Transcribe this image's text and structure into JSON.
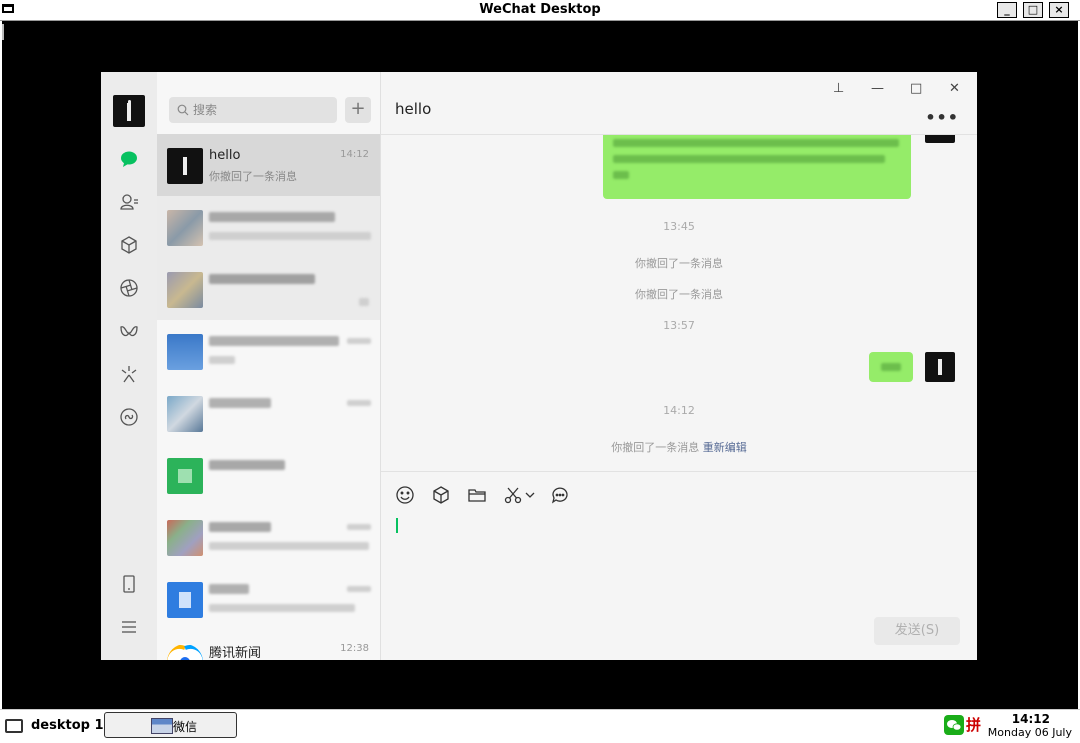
{
  "outer_window": {
    "title": "WeChat Desktop",
    "buttons": [
      "_",
      "□",
      "×"
    ]
  },
  "search": {
    "placeholder": "搜索",
    "plus_label": "+"
  },
  "conversations": [
    {
      "name": "hello",
      "preview": "你撤回了一条消息",
      "time": "14:12",
      "selected": true
    },
    {
      "name": "",
      "preview": "",
      "time": "",
      "blurred": true
    },
    {
      "name": "",
      "preview": "",
      "time": "",
      "blurred": true
    },
    {
      "name": "",
      "preview": "",
      "time": "",
      "blurred": true
    },
    {
      "name": "",
      "preview": "",
      "time": "",
      "blurred": true
    },
    {
      "name": "",
      "preview": "",
      "time": "",
      "blurred": true
    },
    {
      "name": "",
      "preview": "",
      "time": "",
      "blurred": true
    },
    {
      "name": "",
      "preview": "",
      "time": "",
      "blurred": true
    },
    {
      "name": "腾讯新闻",
      "preview": "…",
      "time": "12:38"
    }
  ],
  "chat": {
    "title": "hello",
    "more_label": "•••",
    "window_controls": [
      "⊥",
      "—",
      "□",
      "✕"
    ],
    "timestamps": [
      "13:45",
      "13:57",
      "14:12"
    ],
    "recalled_notes": [
      "你撤回了一条消息",
      "你撤回了一条消息"
    ],
    "last_recall": {
      "text": "你撤回了一条消息",
      "link": "重新编辑"
    },
    "send_label": "发送(S)"
  },
  "nav_icons": [
    "chat-icon",
    "contacts-icon",
    "favorites-icon",
    "moments-icon",
    "channels-icon",
    "search-discover-icon",
    "mini-program-icon",
    "phone-icon",
    "menu-icon"
  ],
  "toolbar_icons": [
    "emoji-icon",
    "favorites-icon",
    "folder-icon",
    "scissors-icon",
    "chevron-down-icon",
    "chat-history-icon"
  ],
  "taskbar": {
    "desktop_label": "desktop 1",
    "task_label": "微信",
    "tray_label": "拼",
    "clock_time": "14:12",
    "clock_date": "Monday 06 July"
  },
  "colors": {
    "accent": "#07c160",
    "bubble": "#95ec69",
    "link": "#576b95"
  }
}
